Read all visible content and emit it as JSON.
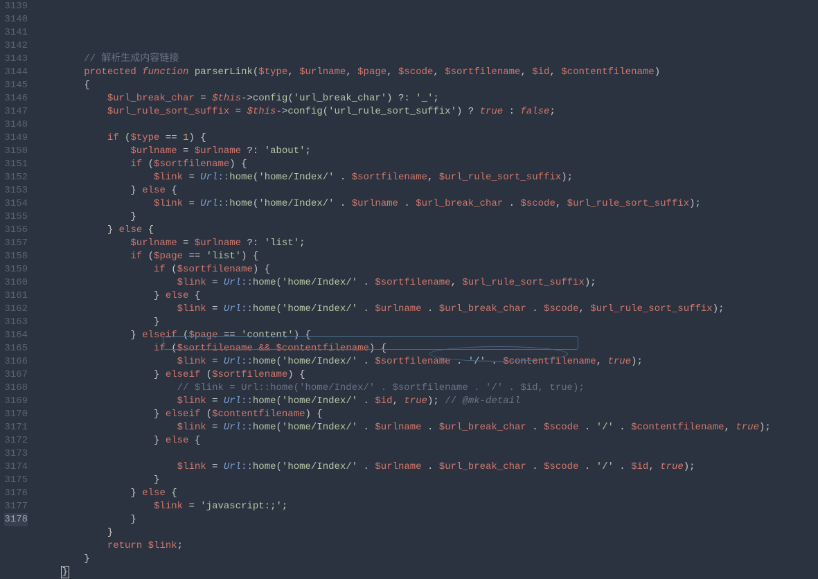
{
  "startLine": 3139,
  "endLine": 3178,
  "activeLine": 3178,
  "code": {
    "l3139": {
      "indent": 2,
      "tokens": [
        {
          "t": "// 解析生成内容链接",
          "c": "c-comment"
        }
      ]
    },
    "l3140": {
      "indent": 2,
      "tokens": [
        {
          "t": "protected",
          "c": "c-keyword"
        },
        {
          "t": " "
        },
        {
          "t": "function",
          "c": "c-keyword-it"
        },
        {
          "t": " "
        },
        {
          "t": "parserLink",
          "c": "c-func"
        },
        {
          "t": "("
        },
        {
          "t": "$type",
          "c": "c-var"
        },
        {
          "t": ", "
        },
        {
          "t": "$urlname",
          "c": "c-var"
        },
        {
          "t": ", "
        },
        {
          "t": "$page",
          "c": "c-var"
        },
        {
          "t": ", "
        },
        {
          "t": "$scode",
          "c": "c-var"
        },
        {
          "t": ", "
        },
        {
          "t": "$sortfilename",
          "c": "c-var"
        },
        {
          "t": ", "
        },
        {
          "t": "$id",
          "c": "c-var"
        },
        {
          "t": ", "
        },
        {
          "t": "$contentfilename",
          "c": "c-var"
        },
        {
          "t": ")"
        }
      ]
    },
    "l3141": {
      "indent": 2,
      "tokens": [
        {
          "t": "{"
        }
      ]
    },
    "l3142": {
      "indent": 3,
      "tokens": [
        {
          "t": "$url_break_char",
          "c": "c-var"
        },
        {
          "t": " = "
        },
        {
          "t": "$this",
          "c": "c-var c-it"
        },
        {
          "t": "->"
        },
        {
          "t": "config",
          "c": "c-method"
        },
        {
          "t": "("
        },
        {
          "t": "'url_break_char'",
          "c": "c-string"
        },
        {
          "t": ") ?: "
        },
        {
          "t": "'_'",
          "c": "c-string"
        },
        {
          "t": ";"
        }
      ]
    },
    "l3143": {
      "indent": 3,
      "tokens": [
        {
          "t": "$url_rule_sort_suffix",
          "c": "c-var"
        },
        {
          "t": " = "
        },
        {
          "t": "$this",
          "c": "c-var c-it"
        },
        {
          "t": "->"
        },
        {
          "t": "config",
          "c": "c-method"
        },
        {
          "t": "("
        },
        {
          "t": "'url_rule_sort_suffix'",
          "c": "c-string"
        },
        {
          "t": ") ? "
        },
        {
          "t": "true",
          "c": "c-const"
        },
        {
          "t": " : "
        },
        {
          "t": "false",
          "c": "c-const"
        },
        {
          "t": ";"
        }
      ]
    },
    "l3144": {
      "indent": 0,
      "tokens": []
    },
    "l3145": {
      "indent": 3,
      "tokens": [
        {
          "t": "if",
          "c": "c-keyword"
        },
        {
          "t": " ("
        },
        {
          "t": "$type",
          "c": "c-var"
        },
        {
          "t": " == "
        },
        {
          "t": "1",
          "c": "c-num"
        },
        {
          "t": ") {"
        }
      ]
    },
    "l3146": {
      "indent": 4,
      "tokens": [
        {
          "t": "$urlname",
          "c": "c-var"
        },
        {
          "t": " = "
        },
        {
          "t": "$urlname",
          "c": "c-var"
        },
        {
          "t": " ?: "
        },
        {
          "t": "'about'",
          "c": "c-string"
        },
        {
          "t": ";"
        }
      ]
    },
    "l3147": {
      "indent": 4,
      "tokens": [
        {
          "t": "if",
          "c": "c-keyword"
        },
        {
          "t": " ("
        },
        {
          "t": "$sortfilename",
          "c": "c-var"
        },
        {
          "t": ") {"
        }
      ]
    },
    "l3148": {
      "indent": 5,
      "tokens": [
        {
          "t": "$link",
          "c": "c-var"
        },
        {
          "t": " = "
        },
        {
          "t": "Url",
          "c": "c-class"
        },
        {
          "t": "::",
          "c": "c-op"
        },
        {
          "t": "home",
          "c": "c-method"
        },
        {
          "t": "("
        },
        {
          "t": "'home/Index/'",
          "c": "c-string"
        },
        {
          "t": " . "
        },
        {
          "t": "$sortfilename",
          "c": "c-var"
        },
        {
          "t": ", "
        },
        {
          "t": "$url_rule_sort_suffix",
          "c": "c-var"
        },
        {
          "t": ");"
        }
      ]
    },
    "l3149": {
      "indent": 4,
      "tokens": [
        {
          "t": "} "
        },
        {
          "t": "else",
          "c": "c-keyword"
        },
        {
          "t": " {"
        }
      ]
    },
    "l3150": {
      "indent": 5,
      "tokens": [
        {
          "t": "$link",
          "c": "c-var"
        },
        {
          "t": " = "
        },
        {
          "t": "Url",
          "c": "c-class"
        },
        {
          "t": "::",
          "c": "c-op"
        },
        {
          "t": "home",
          "c": "c-method"
        },
        {
          "t": "("
        },
        {
          "t": "'home/Index/'",
          "c": "c-string"
        },
        {
          "t": " . "
        },
        {
          "t": "$urlname",
          "c": "c-var"
        },
        {
          "t": " . "
        },
        {
          "t": "$url_break_char",
          "c": "c-var"
        },
        {
          "t": " . "
        },
        {
          "t": "$scode",
          "c": "c-var"
        },
        {
          "t": ", "
        },
        {
          "t": "$url_rule_sort_suffix",
          "c": "c-var"
        },
        {
          "t": ");"
        }
      ]
    },
    "l3151": {
      "indent": 4,
      "tokens": [
        {
          "t": "}"
        }
      ]
    },
    "l3152": {
      "indent": 3,
      "tokens": [
        {
          "t": "} "
        },
        {
          "t": "else",
          "c": "c-keyword"
        },
        {
          "t": " {"
        }
      ]
    },
    "l3153": {
      "indent": 4,
      "tokens": [
        {
          "t": "$urlname",
          "c": "c-var"
        },
        {
          "t": " = "
        },
        {
          "t": "$urlname",
          "c": "c-var"
        },
        {
          "t": " ?: "
        },
        {
          "t": "'list'",
          "c": "c-string"
        },
        {
          "t": ";"
        }
      ]
    },
    "l3154": {
      "indent": 4,
      "tokens": [
        {
          "t": "if",
          "c": "c-keyword"
        },
        {
          "t": " ("
        },
        {
          "t": "$page",
          "c": "c-var"
        },
        {
          "t": " == "
        },
        {
          "t": "'list'",
          "c": "c-string"
        },
        {
          "t": ") {"
        }
      ]
    },
    "l3155": {
      "indent": 5,
      "tokens": [
        {
          "t": "if",
          "c": "c-keyword"
        },
        {
          "t": " ("
        },
        {
          "t": "$sortfilename",
          "c": "c-var"
        },
        {
          "t": ") {"
        }
      ]
    },
    "l3156": {
      "indent": 6,
      "tokens": [
        {
          "t": "$link",
          "c": "c-var"
        },
        {
          "t": " = "
        },
        {
          "t": "Url",
          "c": "c-class"
        },
        {
          "t": "::",
          "c": "c-op"
        },
        {
          "t": "home",
          "c": "c-method"
        },
        {
          "t": "("
        },
        {
          "t": "'home/Index/'",
          "c": "c-string"
        },
        {
          "t": " . "
        },
        {
          "t": "$sortfilename",
          "c": "c-var"
        },
        {
          "t": ", "
        },
        {
          "t": "$url_rule_sort_suffix",
          "c": "c-var"
        },
        {
          "t": ");"
        }
      ]
    },
    "l3157": {
      "indent": 5,
      "tokens": [
        {
          "t": "} "
        },
        {
          "t": "else",
          "c": "c-keyword"
        },
        {
          "t": " {"
        }
      ]
    },
    "l3158": {
      "indent": 6,
      "tokens": [
        {
          "t": "$link",
          "c": "c-var"
        },
        {
          "t": " = "
        },
        {
          "t": "Url",
          "c": "c-class"
        },
        {
          "t": "::",
          "c": "c-op"
        },
        {
          "t": "home",
          "c": "c-method"
        },
        {
          "t": "("
        },
        {
          "t": "'home/Index/'",
          "c": "c-string"
        },
        {
          "t": " . "
        },
        {
          "t": "$urlname",
          "c": "c-var"
        },
        {
          "t": " . "
        },
        {
          "t": "$url_break_char",
          "c": "c-var"
        },
        {
          "t": " . "
        },
        {
          "t": "$scode",
          "c": "c-var"
        },
        {
          "t": ", "
        },
        {
          "t": "$url_rule_sort_suffix",
          "c": "c-var"
        },
        {
          "t": ");"
        }
      ]
    },
    "l3159": {
      "indent": 5,
      "tokens": [
        {
          "t": "}"
        }
      ]
    },
    "l3160": {
      "indent": 4,
      "tokens": [
        {
          "t": "} "
        },
        {
          "t": "elseif",
          "c": "c-keyword"
        },
        {
          "t": " ("
        },
        {
          "t": "$page",
          "c": "c-var"
        },
        {
          "t": " == "
        },
        {
          "t": "'content'",
          "c": "c-string"
        },
        {
          "t": ") {"
        }
      ]
    },
    "l3161": {
      "indent": 5,
      "tokens": [
        {
          "t": "if",
          "c": "c-keyword"
        },
        {
          "t": " ("
        },
        {
          "t": "$sortfilename",
          "c": "c-var"
        },
        {
          "t": " "
        },
        {
          "t": "&&",
          "c": "c-keyword"
        },
        {
          "t": " "
        },
        {
          "t": "$contentfilename",
          "c": "c-var"
        },
        {
          "t": ") {"
        }
      ]
    },
    "l3162": {
      "indent": 6,
      "tokens": [
        {
          "t": "$link",
          "c": "c-var"
        },
        {
          "t": " = "
        },
        {
          "t": "Url",
          "c": "c-class"
        },
        {
          "t": "::",
          "c": "c-op"
        },
        {
          "t": "home",
          "c": "c-method"
        },
        {
          "t": "("
        },
        {
          "t": "'home/Index/'",
          "c": "c-string"
        },
        {
          "t": " . "
        },
        {
          "t": "$sortfilename",
          "c": "c-var"
        },
        {
          "t": " . "
        },
        {
          "t": "'/'",
          "c": "c-string"
        },
        {
          "t": " . "
        },
        {
          "t": "$contentfilename",
          "c": "c-var"
        },
        {
          "t": ", "
        },
        {
          "t": "true",
          "c": "c-const"
        },
        {
          "t": ");"
        }
      ]
    },
    "l3163": {
      "indent": 5,
      "tokens": [
        {
          "t": "} "
        },
        {
          "t": "elseif",
          "c": "c-keyword"
        },
        {
          "t": " ("
        },
        {
          "t": "$sortfilename",
          "c": "c-var"
        },
        {
          "t": ") {"
        }
      ]
    },
    "l3164": {
      "indent": 6,
      "tokens": [
        {
          "t": "// ",
          "c": "c-comment"
        },
        {
          "t": "$link = Url::home('home/Index/' . $sortfilename . '/' . $id, true);",
          "c": "c-commentcode"
        }
      ]
    },
    "l3165": {
      "indent": 6,
      "tokens": [
        {
          "t": "$link",
          "c": "c-var"
        },
        {
          "t": " = "
        },
        {
          "t": "Url",
          "c": "c-class"
        },
        {
          "t": "::",
          "c": "c-op"
        },
        {
          "t": "home",
          "c": "c-method"
        },
        {
          "t": "("
        },
        {
          "t": "'home/Index/'",
          "c": "c-string"
        },
        {
          "t": " . "
        },
        {
          "t": "$id",
          "c": "c-var"
        },
        {
          "t": ", "
        },
        {
          "t": "true",
          "c": "c-const"
        },
        {
          "t": "); "
        },
        {
          "t": "// ",
          "c": "c-comment"
        },
        {
          "t": "@mk-detail",
          "c": "c-comment c-it"
        }
      ]
    },
    "l3166": {
      "indent": 5,
      "tokens": [
        {
          "t": "} "
        },
        {
          "t": "elseif",
          "c": "c-keyword"
        },
        {
          "t": " ("
        },
        {
          "t": "$contentfilename",
          "c": "c-var"
        },
        {
          "t": ") {"
        }
      ]
    },
    "l3167": {
      "indent": 6,
      "tokens": [
        {
          "t": "$link",
          "c": "c-var"
        },
        {
          "t": " = "
        },
        {
          "t": "Url",
          "c": "c-class"
        },
        {
          "t": "::",
          "c": "c-op"
        },
        {
          "t": "home",
          "c": "c-method"
        },
        {
          "t": "("
        },
        {
          "t": "'home/Index/'",
          "c": "c-string"
        },
        {
          "t": " . "
        },
        {
          "t": "$urlname",
          "c": "c-var"
        },
        {
          "t": " . "
        },
        {
          "t": "$url_break_char",
          "c": "c-var"
        },
        {
          "t": " . "
        },
        {
          "t": "$scode",
          "c": "c-var"
        },
        {
          "t": " . "
        },
        {
          "t": "'/'",
          "c": "c-string"
        },
        {
          "t": " . "
        },
        {
          "t": "$contentfilename",
          "c": "c-var"
        },
        {
          "t": ", "
        },
        {
          "t": "true",
          "c": "c-const"
        },
        {
          "t": ");"
        }
      ]
    },
    "l3168": {
      "indent": 5,
      "tokens": [
        {
          "t": "} "
        },
        {
          "t": "else",
          "c": "c-keyword"
        },
        {
          "t": " {"
        }
      ]
    },
    "l3169": {
      "indent": 0,
      "tokens": []
    },
    "l3170": {
      "indent": 6,
      "tokens": [
        {
          "t": "$link",
          "c": "c-var"
        },
        {
          "t": " = "
        },
        {
          "t": "Url",
          "c": "c-class"
        },
        {
          "t": "::",
          "c": "c-op"
        },
        {
          "t": "home",
          "c": "c-method"
        },
        {
          "t": "("
        },
        {
          "t": "'home/Index/'",
          "c": "c-string"
        },
        {
          "t": " . "
        },
        {
          "t": "$urlname",
          "c": "c-var"
        },
        {
          "t": " . "
        },
        {
          "t": "$url_break_char",
          "c": "c-var"
        },
        {
          "t": " . "
        },
        {
          "t": "$scode",
          "c": "c-var"
        },
        {
          "t": " . "
        },
        {
          "t": "'/'",
          "c": "c-string"
        },
        {
          "t": " . "
        },
        {
          "t": "$id",
          "c": "c-var"
        },
        {
          "t": ", "
        },
        {
          "t": "true",
          "c": "c-const"
        },
        {
          "t": ");"
        }
      ]
    },
    "l3171": {
      "indent": 5,
      "tokens": [
        {
          "t": "}"
        }
      ]
    },
    "l3172": {
      "indent": 4,
      "tokens": [
        {
          "t": "} "
        },
        {
          "t": "else",
          "c": "c-keyword"
        },
        {
          "t": " {"
        }
      ]
    },
    "l3173": {
      "indent": 5,
      "tokens": [
        {
          "t": "$link",
          "c": "c-var"
        },
        {
          "t": " = "
        },
        {
          "t": "'javascript:;'",
          "c": "c-string"
        },
        {
          "t": ";"
        }
      ]
    },
    "l3174": {
      "indent": 4,
      "tokens": [
        {
          "t": "}"
        }
      ]
    },
    "l3175": {
      "indent": 3,
      "tokens": [
        {
          "t": "}"
        }
      ]
    },
    "l3176": {
      "indent": 3,
      "tokens": [
        {
          "t": "return",
          "c": "c-keyword"
        },
        {
          "t": " "
        },
        {
          "t": "$link",
          "c": "c-var"
        },
        {
          "t": ";"
        }
      ]
    },
    "l3177": {
      "indent": 2,
      "tokens": [
        {
          "t": "}"
        }
      ]
    },
    "l3178": {
      "indent": 1,
      "tokens": [
        {
          "t": "}",
          "c": "cursor-br"
        }
      ]
    }
  }
}
